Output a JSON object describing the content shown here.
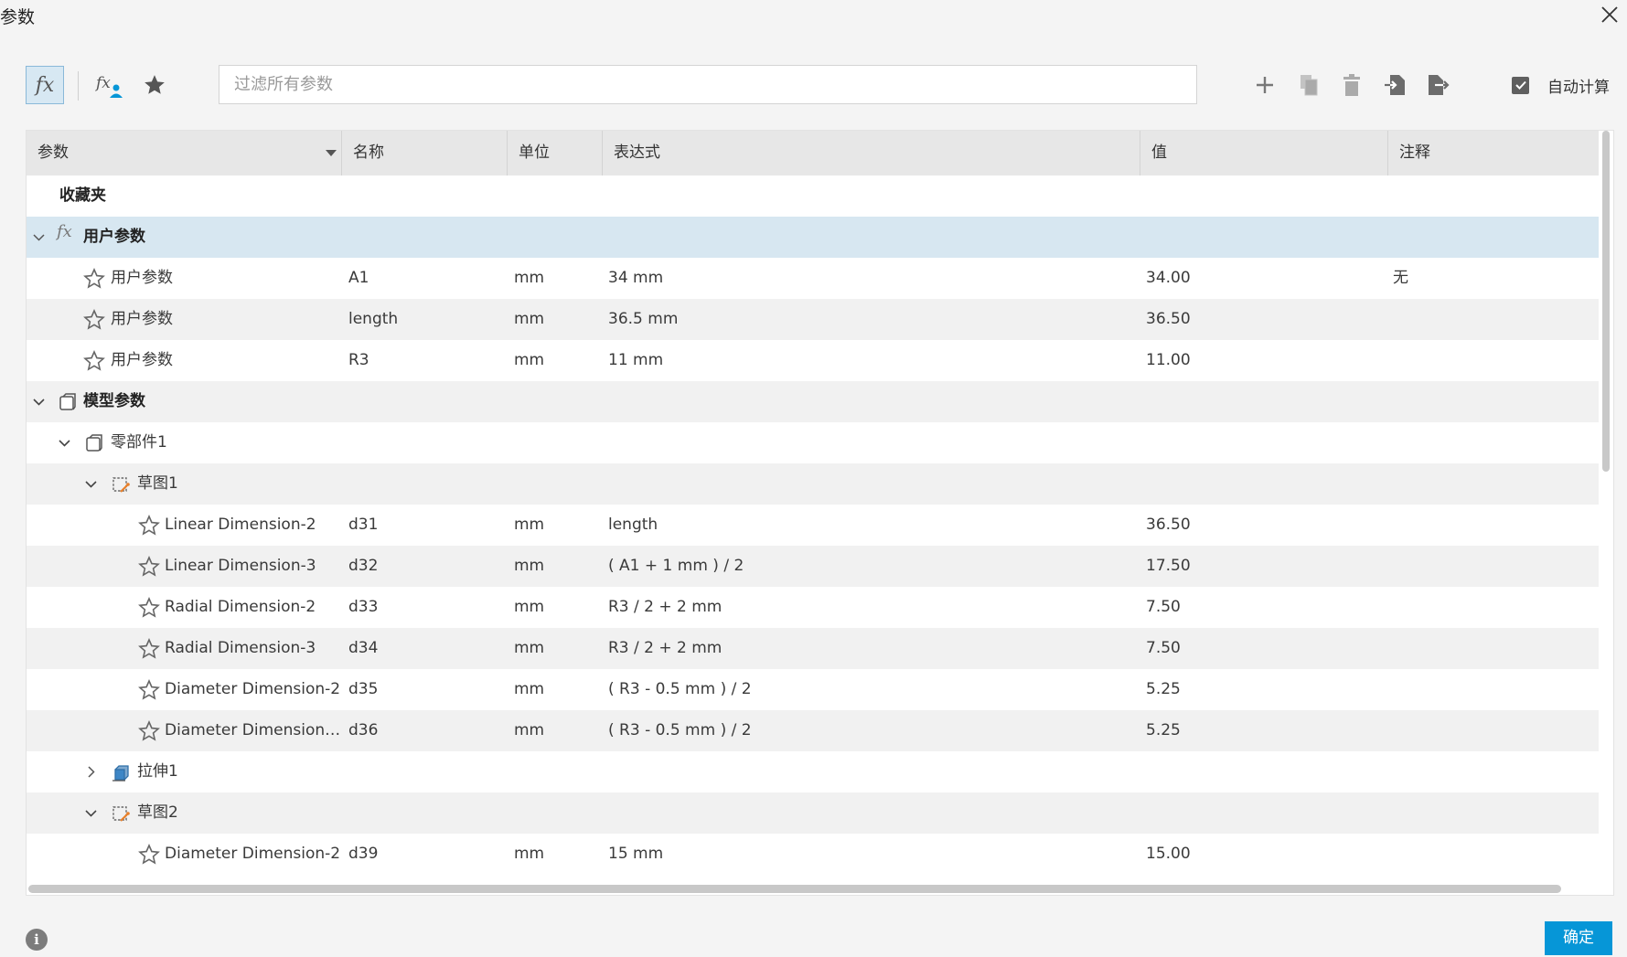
{
  "window": {
    "title": "参数"
  },
  "toolbar": {
    "filter_placeholder": "过滤所有参数",
    "auto_calc_label": "自动计算",
    "auto_calc_checked": true,
    "tool_icons": [
      "fx-all-params-icon",
      "fx-user-params-icon",
      "star-favorites-icon"
    ],
    "action_icons": [
      "plus-icon",
      "copy-icon",
      "trash-icon",
      "import-icon",
      "export-icon"
    ]
  },
  "table": {
    "columns": [
      "参数",
      "名称",
      "单位",
      "表达式",
      "值",
      "注释"
    ],
    "favorites_label": "收藏夹",
    "user_group": {
      "label": "用户参数"
    },
    "user_rows": [
      {
        "param": "用户参数",
        "name": "A1",
        "unit": "mm",
        "expr": "34 mm",
        "value": "34.00",
        "note": "无"
      },
      {
        "param": "用户参数",
        "name": "length",
        "unit": "mm",
        "expr": "36.5 mm",
        "value": "36.50",
        "note": ""
      },
      {
        "param": "用户参数",
        "name": "R3",
        "unit": "mm",
        "expr": "11 mm",
        "value": "11.00",
        "note": ""
      }
    ],
    "model_group": {
      "label": "模型参数"
    },
    "component": {
      "label": "零部件1"
    },
    "sketch1": {
      "label": "草图1"
    },
    "sketch1_rows": [
      {
        "param": "Linear Dimension-2",
        "name": "d31",
        "unit": "mm",
        "expr": "length",
        "value": "36.50"
      },
      {
        "param": "Linear Dimension-3",
        "name": "d32",
        "unit": "mm",
        "expr": "( A1 + 1 mm ) / 2",
        "value": "17.50"
      },
      {
        "param": "Radial Dimension-2",
        "name": "d33",
        "unit": "mm",
        "expr": "R3 / 2 + 2 mm",
        "value": "7.50"
      },
      {
        "param": "Radial Dimension-3",
        "name": "d34",
        "unit": "mm",
        "expr": "R3 / 2 + 2 mm",
        "value": "7.50"
      },
      {
        "param": "Diameter Dimension-2",
        "name": "d35",
        "unit": "mm",
        "expr": "( R3 - 0.5 mm ) / 2",
        "value": "5.25"
      },
      {
        "param": "Diameter Dimension…",
        "name": "d36",
        "unit": "mm",
        "expr": "( R3 - 0.5 mm ) / 2",
        "value": "5.25"
      }
    ],
    "extrude": {
      "label": "拉伸1"
    },
    "sketch2": {
      "label": "草图2"
    },
    "sketch2_rows": [
      {
        "param": "Diameter Dimension-2",
        "name": "d39",
        "unit": "mm",
        "expr": "15 mm",
        "value": "15.00"
      }
    ]
  },
  "footer": {
    "ok_label": "确定"
  },
  "colors": {
    "accent": "#0696d7",
    "selected_row": "#d7e7f1",
    "alt_row": "#f1f1f1",
    "header_bg": "#e7e7e7"
  }
}
